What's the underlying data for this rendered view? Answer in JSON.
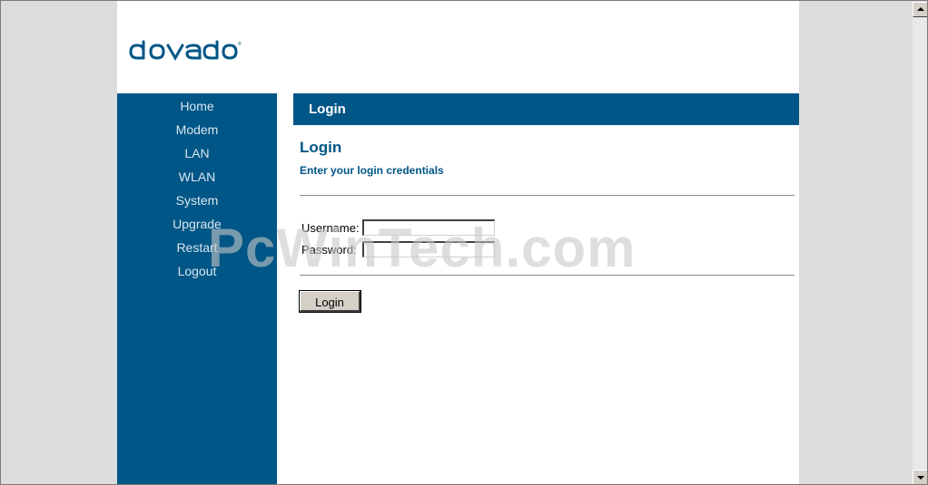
{
  "brand": {
    "logo_text": "dovado",
    "color": "#005686"
  },
  "sidebar": {
    "items": [
      {
        "label": "Home"
      },
      {
        "label": "Modem"
      },
      {
        "label": "LAN"
      },
      {
        "label": "WLAN"
      },
      {
        "label": "System"
      },
      {
        "label": "Upgrade"
      },
      {
        "label": "Restart"
      },
      {
        "label": "Logout"
      }
    ]
  },
  "header": {
    "title": "Login"
  },
  "main": {
    "heading": "Login",
    "subheading": "Enter your login credentials",
    "username_label": "Username:",
    "username_value": "",
    "password_label": "Password:",
    "password_value": "",
    "login_button": "Login"
  },
  "watermark": "PcWinTech.com",
  "scrollbar": {
    "up_icon": "arrow-up-icon",
    "down_icon": "arrow-down-icon"
  }
}
